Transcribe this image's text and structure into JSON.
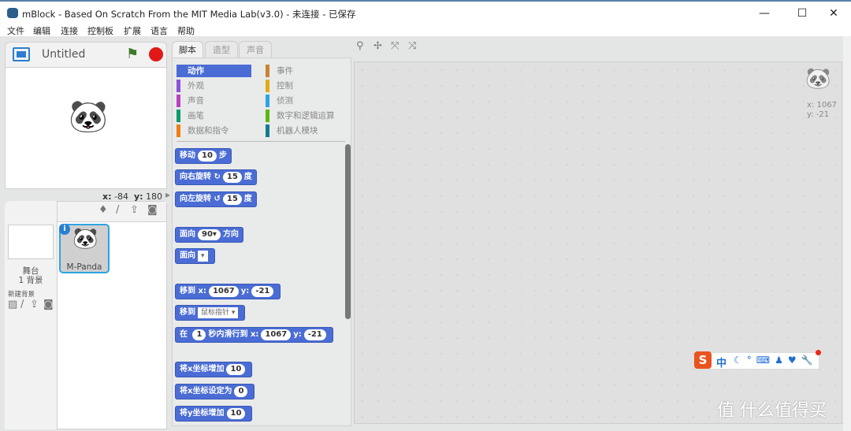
{
  "window": {
    "title": "mBlock - Based On Scratch From the MIT Media Lab(v3.0) - 未连接 - 已保存",
    "minimize": "—",
    "maximize": "☐",
    "close": "✕"
  },
  "menu": [
    "文件",
    "编辑",
    "连接",
    "控制板",
    "扩展",
    "语言",
    "帮助"
  ],
  "stage": {
    "project_name": "Untitled",
    "x_label": "x:",
    "x": "-84",
    "y_label": "y:",
    "y": "180"
  },
  "sprites": {
    "stage_label": "舞台",
    "backdrops": "1 背景",
    "new_backdrop": "新建背景",
    "items": [
      {
        "name": "M-Panda"
      }
    ]
  },
  "tabs": [
    "脚本",
    "造型",
    "声音"
  ],
  "categories": [
    {
      "label": "动作",
      "color": "#4a6cd4",
      "active": true
    },
    {
      "label": "事件",
      "color": "#c88330"
    },
    {
      "label": "外观",
      "color": "#8a55d7"
    },
    {
      "label": "控制",
      "color": "#e1a91a"
    },
    {
      "label": "声音",
      "color": "#bb42c3"
    },
    {
      "label": "侦测",
      "color": "#2ca5e2"
    },
    {
      "label": "画笔",
      "color": "#0e9a6c"
    },
    {
      "label": "数字和逻辑运算",
      "color": "#5cb712"
    },
    {
      "label": "数据和指令",
      "color": "#ee7d16"
    },
    {
      "label": "机器人模块",
      "color": "#127b8c"
    }
  ],
  "blocks": {
    "move": {
      "a": "移动",
      "v": "10",
      "b": "步"
    },
    "turn_right": {
      "a": "向右旋转",
      "icon": "↻",
      "v": "15",
      "b": "度"
    },
    "turn_left": {
      "a": "向左旋转",
      "icon": "↺",
      "v": "15",
      "b": "度"
    },
    "point_dir": {
      "a": "面向",
      "v": "90▾",
      "b": "方向"
    },
    "point_towards": {
      "a": "面向",
      "v": "▾"
    },
    "goto_xy": {
      "a": "移到",
      "xl": "x:",
      "x": "1067",
      "yl": "y:",
      "y": "-21"
    },
    "goto": {
      "a": "移到",
      "v": "鼠标指针 ▾"
    },
    "glide": {
      "a": "在",
      "t": "1",
      "b": "秒内滑行到",
      "xl": "x:",
      "x": "1067",
      "yl": "y:",
      "y": "-21"
    },
    "change_x": {
      "a": "将x坐标增加",
      "v": "10"
    },
    "set_x": {
      "a": "将x坐标设定为",
      "v": "0"
    },
    "change_y": {
      "a": "将y坐标增加",
      "v": "10"
    }
  },
  "script_area": {
    "x": "x: 1067",
    "y": "y: -21"
  },
  "ime": {
    "label": "中",
    "logo": "S"
  },
  "watermark": "值 什么值得买"
}
